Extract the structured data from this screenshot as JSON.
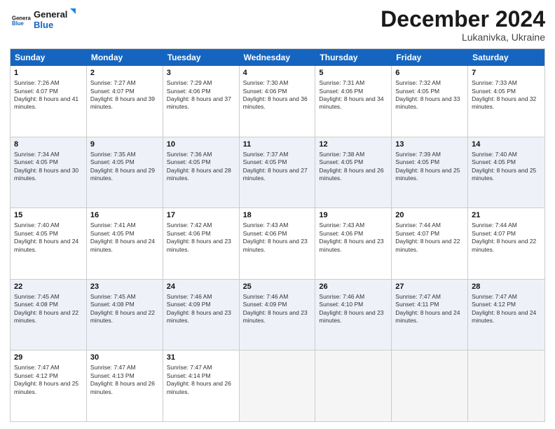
{
  "logo": {
    "line1": "General",
    "line2": "Blue",
    "icon_color": "#1e88e5"
  },
  "title": "December 2024",
  "location": "Lukanivka, Ukraine",
  "days": [
    "Sunday",
    "Monday",
    "Tuesday",
    "Wednesday",
    "Thursday",
    "Friday",
    "Saturday"
  ],
  "weeks": [
    [
      {
        "day": "1",
        "sunrise": "7:26 AM",
        "sunset": "4:07 PM",
        "daylight": "8 hours and 41 minutes."
      },
      {
        "day": "2",
        "sunrise": "7:27 AM",
        "sunset": "4:07 PM",
        "daylight": "8 hours and 39 minutes."
      },
      {
        "day": "3",
        "sunrise": "7:29 AM",
        "sunset": "4:06 PM",
        "daylight": "8 hours and 37 minutes."
      },
      {
        "day": "4",
        "sunrise": "7:30 AM",
        "sunset": "4:06 PM",
        "daylight": "8 hours and 36 minutes."
      },
      {
        "day": "5",
        "sunrise": "7:31 AM",
        "sunset": "4:06 PM",
        "daylight": "8 hours and 34 minutes."
      },
      {
        "day": "6",
        "sunrise": "7:32 AM",
        "sunset": "4:05 PM",
        "daylight": "8 hours and 33 minutes."
      },
      {
        "day": "7",
        "sunrise": "7:33 AM",
        "sunset": "4:05 PM",
        "daylight": "8 hours and 32 minutes."
      }
    ],
    [
      {
        "day": "8",
        "sunrise": "7:34 AM",
        "sunset": "4:05 PM",
        "daylight": "8 hours and 30 minutes."
      },
      {
        "day": "9",
        "sunrise": "7:35 AM",
        "sunset": "4:05 PM",
        "daylight": "8 hours and 29 minutes."
      },
      {
        "day": "10",
        "sunrise": "7:36 AM",
        "sunset": "4:05 PM",
        "daylight": "8 hours and 28 minutes."
      },
      {
        "day": "11",
        "sunrise": "7:37 AM",
        "sunset": "4:05 PM",
        "daylight": "8 hours and 27 minutes."
      },
      {
        "day": "12",
        "sunrise": "7:38 AM",
        "sunset": "4:05 PM",
        "daylight": "8 hours and 26 minutes."
      },
      {
        "day": "13",
        "sunrise": "7:39 AM",
        "sunset": "4:05 PM",
        "daylight": "8 hours and 25 minutes."
      },
      {
        "day": "14",
        "sunrise": "7:40 AM",
        "sunset": "4:05 PM",
        "daylight": "8 hours and 25 minutes."
      }
    ],
    [
      {
        "day": "15",
        "sunrise": "7:40 AM",
        "sunset": "4:05 PM",
        "daylight": "8 hours and 24 minutes."
      },
      {
        "day": "16",
        "sunrise": "7:41 AM",
        "sunset": "4:05 PM",
        "daylight": "8 hours and 24 minutes."
      },
      {
        "day": "17",
        "sunrise": "7:42 AM",
        "sunset": "4:06 PM",
        "daylight": "8 hours and 23 minutes."
      },
      {
        "day": "18",
        "sunrise": "7:43 AM",
        "sunset": "4:06 PM",
        "daylight": "8 hours and 23 minutes."
      },
      {
        "day": "19",
        "sunrise": "7:43 AM",
        "sunset": "4:06 PM",
        "daylight": "8 hours and 23 minutes."
      },
      {
        "day": "20",
        "sunrise": "7:44 AM",
        "sunset": "4:07 PM",
        "daylight": "8 hours and 22 minutes."
      },
      {
        "day": "21",
        "sunrise": "7:44 AM",
        "sunset": "4:07 PM",
        "daylight": "8 hours and 22 minutes."
      }
    ],
    [
      {
        "day": "22",
        "sunrise": "7:45 AM",
        "sunset": "4:08 PM",
        "daylight": "8 hours and 22 minutes."
      },
      {
        "day": "23",
        "sunrise": "7:45 AM",
        "sunset": "4:08 PM",
        "daylight": "8 hours and 22 minutes."
      },
      {
        "day": "24",
        "sunrise": "7:46 AM",
        "sunset": "4:09 PM",
        "daylight": "8 hours and 23 minutes."
      },
      {
        "day": "25",
        "sunrise": "7:46 AM",
        "sunset": "4:09 PM",
        "daylight": "8 hours and 23 minutes."
      },
      {
        "day": "26",
        "sunrise": "7:46 AM",
        "sunset": "4:10 PM",
        "daylight": "8 hours and 23 minutes."
      },
      {
        "day": "27",
        "sunrise": "7:47 AM",
        "sunset": "4:11 PM",
        "daylight": "8 hours and 24 minutes."
      },
      {
        "day": "28",
        "sunrise": "7:47 AM",
        "sunset": "4:12 PM",
        "daylight": "8 hours and 24 minutes."
      }
    ],
    [
      {
        "day": "29",
        "sunrise": "7:47 AM",
        "sunset": "4:12 PM",
        "daylight": "8 hours and 25 minutes."
      },
      {
        "day": "30",
        "sunrise": "7:47 AM",
        "sunset": "4:13 PM",
        "daylight": "8 hours and 26 minutes."
      },
      {
        "day": "31",
        "sunrise": "7:47 AM",
        "sunset": "4:14 PM",
        "daylight": "8 hours and 26 minutes."
      },
      null,
      null,
      null,
      null
    ]
  ]
}
